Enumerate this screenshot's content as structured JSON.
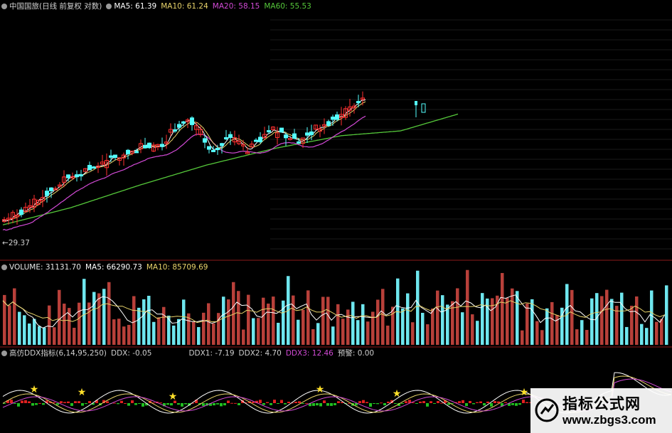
{
  "price_legend": {
    "title": "中国国旅(日线 前复权 对数)",
    "ma5": "MA5: 61.39",
    "ma10": "MA10: 61.24",
    "ma20": "MA20: 58.15",
    "ma60": "MA60: 55.53",
    "low_label": "29.37"
  },
  "volume_legend": {
    "volume": "VOLUME: 31131.70",
    "ma5": "MA5: 66290.73",
    "ma10": "MA10: 85709.69"
  },
  "ddx_legend": {
    "title": "高仿DDX指标(6,14,95,250)",
    "ddx": "DDX: -0.05",
    "ddx1": "DDX1: -7.19",
    "ddx2": "DDX2: 4.70",
    "ddx3": "DDX3: 12.46",
    "alert": "预警: 0.00"
  },
  "watermark": {
    "title": "指标公式网",
    "url": "www.zbgs3.com"
  },
  "colors": {
    "up": "#ff3030",
    "down": "#54ffff",
    "ma5": "#ffffff",
    "ma10": "#e8d36a",
    "ma20": "#d24ad6",
    "ma60": "#55c83a",
    "vol_up": "#b8403a",
    "vol_down": "#6ee6ee",
    "panel_border": "#8b1a1a"
  },
  "chart_data": [
    {
      "type": "candlestick",
      "title": "中国国旅(日线 前复权 对数)",
      "series": [
        {
          "name": "MA5",
          "last": 61.39
        },
        {
          "name": "MA10",
          "last": 61.24
        },
        {
          "name": "MA20",
          "last": 58.15
        },
        {
          "name": "MA60",
          "last": 55.53
        }
      ],
      "annotations": [
        {
          "text": "29.37",
          "position": "bottom-left"
        }
      ],
      "price_path": [
        [
          0,
          30.5
        ],
        [
          15,
          33.5
        ],
        [
          30,
          37.5
        ],
        [
          45,
          42.0
        ],
        [
          60,
          44.5
        ],
        [
          75,
          46.5
        ],
        [
          90,
          49.5
        ],
        [
          100,
          51.0
        ],
        [
          110,
          50.2
        ],
        [
          120,
          55.5
        ],
        [
          130,
          58.5
        ],
        [
          138,
          55.5
        ],
        [
          145,
          49.5
        ],
        [
          152,
          51.0
        ],
        [
          158,
          53.5
        ],
        [
          165,
          51.5
        ],
        [
          172,
          49.0
        ],
        [
          180,
          52.5
        ],
        [
          190,
          55.0
        ],
        [
          200,
          53.5
        ],
        [
          210,
          52.0
        ],
        [
          220,
          55.5
        ],
        [
          230,
          57.5
        ],
        [
          240,
          60.0
        ],
        [
          250,
          63.0
        ],
        [
          255,
          62.5
        ]
      ],
      "ma60_path": [
        [
          0,
          29.37
        ],
        [
          40,
          34.0
        ],
        [
          80,
          40.0
        ],
        [
          120,
          45.5
        ],
        [
          160,
          50.0
        ],
        [
          200,
          53.5
        ],
        [
          235,
          54.8
        ],
        [
          270,
          59.5
        ]
      ]
    },
    {
      "type": "bar",
      "title": "VOLUME",
      "series": [
        {
          "name": "VOLUME",
          "last": 31131.7
        },
        {
          "name": "MA5",
          "last": 66290.73
        },
        {
          "name": "MA10",
          "last": 85709.69
        }
      ]
    },
    {
      "type": "line",
      "title": "高仿DDX指标(6,14,95,250)",
      "series": [
        {
          "name": "DDX",
          "last": -0.05
        },
        {
          "name": "DDX1",
          "last": -7.19
        },
        {
          "name": "DDX2",
          "last": 4.7
        },
        {
          "name": "DDX3",
          "last": 12.46
        },
        {
          "name": "预警",
          "last": 0.0
        }
      ]
    }
  ]
}
